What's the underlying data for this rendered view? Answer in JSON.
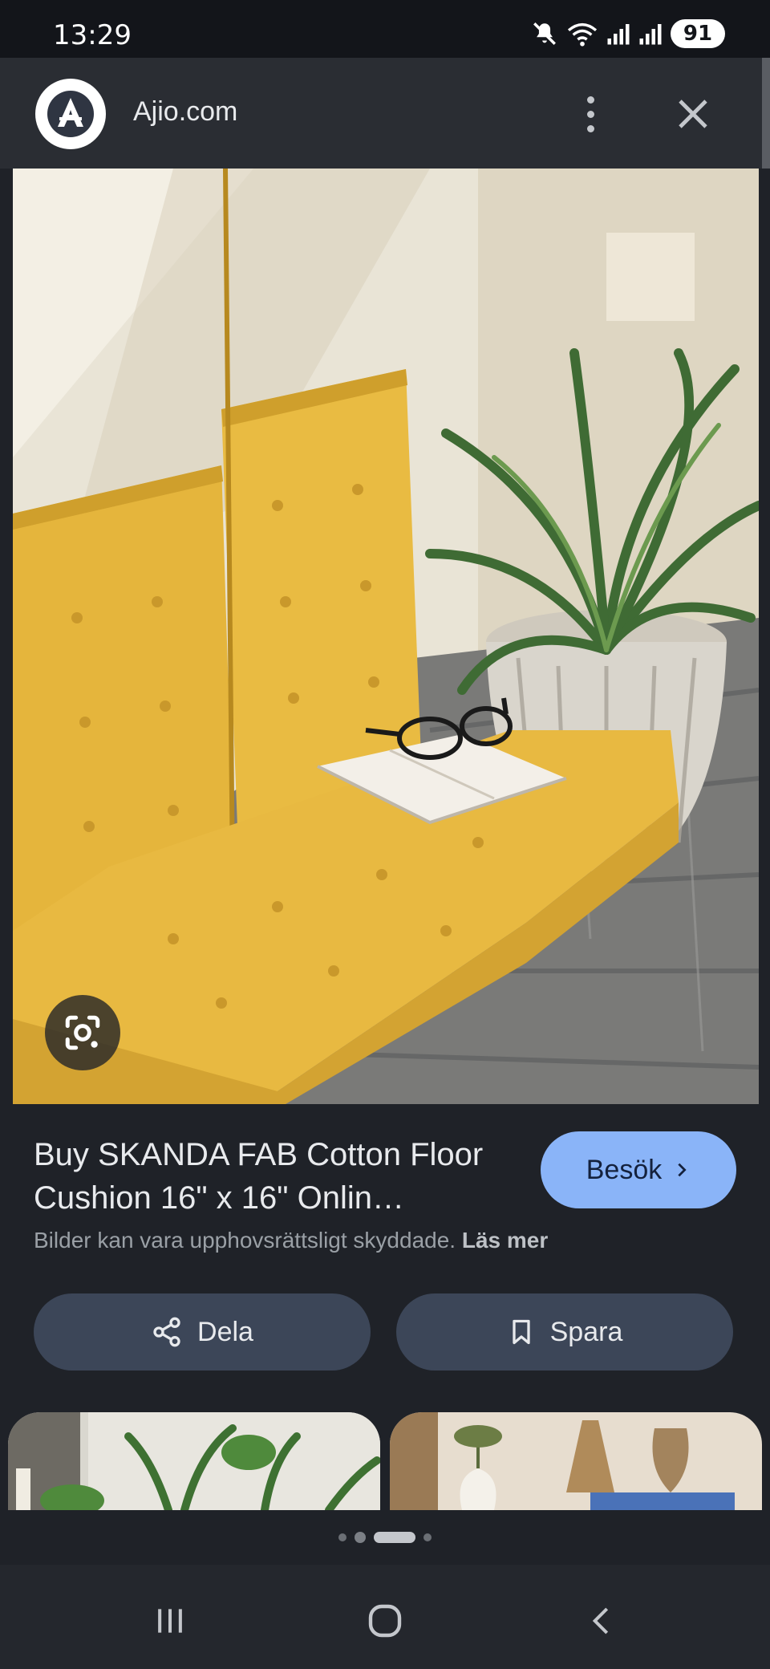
{
  "status_bar": {
    "time": "13:29",
    "battery": "91",
    "icons": [
      "mute-icon",
      "wifi-icon",
      "signal-icon",
      "signal-icon",
      "battery-icon"
    ]
  },
  "header": {
    "site_name": "Ajio.com",
    "logo_icon": "ajio-logo",
    "more_icon": "more-vert-icon",
    "close_icon": "close-icon"
  },
  "result": {
    "title": "Buy SKANDA FAB Cotton Floor Cushion 16\" x 16\" Onlin…",
    "visit_label": "Besök",
    "copyright_notice": "Bilder kan vara upphovsrättsligt skyddade.",
    "read_more": "Läs mer",
    "share_label": "Dela",
    "save_label": "Spara"
  },
  "carousel": {
    "pages": 4,
    "active_index": 2
  },
  "colors": {
    "accent": "#8ab4f8",
    "button_bg": "#3c4658",
    "background": "#1f2228"
  }
}
